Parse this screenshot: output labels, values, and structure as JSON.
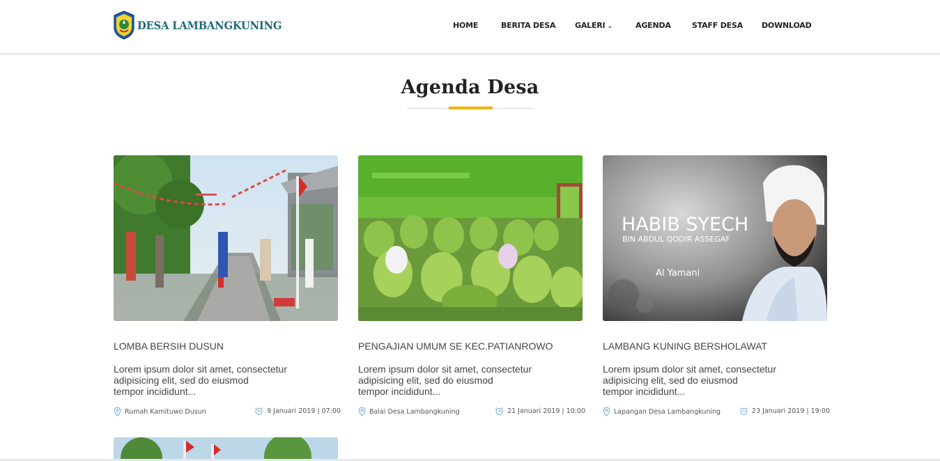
{
  "brand": {
    "name": "DESA LAMBANGKUNING",
    "color": "#1c6b7a"
  },
  "nav": [
    {
      "label": "HOME"
    },
    {
      "label": "BERITA DESA"
    },
    {
      "label": "GALERI",
      "icon": "chevron-down-icon"
    },
    {
      "label": "AGENDA"
    },
    {
      "label": "STAFF DESA"
    },
    {
      "label": "DOWNLOAD"
    }
  ],
  "section": {
    "title": "Agenda Desa",
    "accent_color": "#f2b310"
  },
  "cards": [
    {
      "title": "LOMBA BERSIH DUSUN",
      "desc": [
        "Lorem ipsum dolor sit amet, consectetur",
        "adipisicing elit, sed do eiusmod",
        "tempor incididunt..."
      ],
      "location": "Rumah Kamituwo Dusun",
      "date": "9 Januari 2019 | 07:00"
    },
    {
      "title": "PENGAJIAN UMUM SE KEC.PATIANROWO",
      "desc": [
        "Lorem ipsum dolor sit amet, consectetur",
        "adipisicing elit, sed do eiusmod",
        "tempor incididunt..."
      ],
      "location": "Balai Desa Lambangkuning",
      "date": "21 Januari 2019 | 10:00"
    },
    {
      "title": "LAMBANG KUNING BERSHOLAWAT",
      "desc": [
        "Lorem ipsum dolor sit amet, consectetur",
        "adipisicing elit, sed do eiusmod",
        "tempor incididunt..."
      ],
      "location": "Lapangan Desa Lambangkuning",
      "date": "23 Januari 2019 | 19:00",
      "image_text": {
        "line1": "HABIB SYECH",
        "line2": "BIN ABDUL QODIR ASSEGAF",
        "line3": "Al Yamani"
      }
    }
  ],
  "icons": {
    "location": "map-pin-icon",
    "date": "alarm-clock-icon"
  }
}
